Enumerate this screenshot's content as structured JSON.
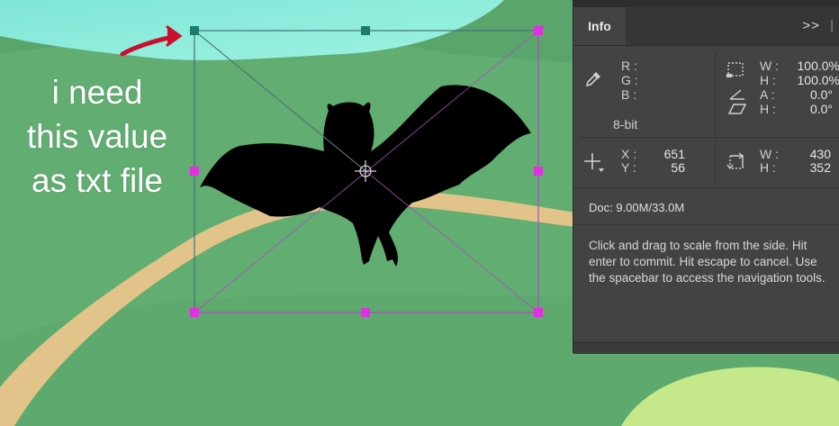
{
  "annotation": {
    "lines": [
      "i need",
      "this value",
      "as txt file"
    ]
  },
  "panel": {
    "tab_label": "Info",
    "menu_glyph": ">>",
    "menu_sep": "|",
    "color": {
      "r_label": "R :",
      "g_label": "G :",
      "b_label": "B :",
      "bit_depth": "8-bit"
    },
    "scale": {
      "w_label": "W :",
      "w_value": "100.0%",
      "h_label": "H :",
      "h_value": "100.0%",
      "a_label": "A :",
      "a_value": "0.0°",
      "h2_label": "H :",
      "h2_value": "0.0°"
    },
    "position": {
      "x_label": "X :",
      "x_value": "651",
      "y_label": "Y :",
      "y_value": "56"
    },
    "size": {
      "w_label": "W :",
      "w_value": "430",
      "h_label": "H :",
      "h_value": "352"
    },
    "doc": "Doc: 9.00M/33.0M",
    "help": "Click and drag to scale from the side. Hit enter to commit. Hit escape to cancel. Use the spacebar to access the navigation tools."
  },
  "colors": {
    "panel_bg": "#434343",
    "annotation_arrow": "#c8102e",
    "transform_box": "#b04ac0",
    "handle": "#e030e0",
    "anchor_handle": "#1e7a6a"
  },
  "icons": [
    "eyedropper-icon",
    "scale-icon",
    "angle-icon",
    "skew-icon",
    "crosshair-icon",
    "size-icon"
  ]
}
